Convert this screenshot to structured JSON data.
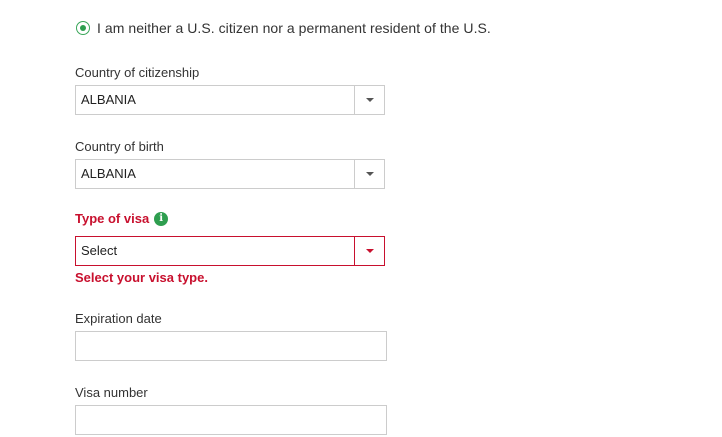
{
  "residency": {
    "option_label": "I am neither a U.S. citizen nor a permanent resident of the U.S.",
    "selected": true
  },
  "fields": {
    "citizenship": {
      "label": "Country of citizenship",
      "value": "ALBANIA"
    },
    "birth": {
      "label": "Country of birth",
      "value": "ALBANIA"
    },
    "visa_type": {
      "label": "Type of visa",
      "value": "Select",
      "error": "Select your visa type.",
      "info_icon": "i"
    },
    "expiration": {
      "label": "Expiration date",
      "value": ""
    },
    "visa_number": {
      "label": "Visa number",
      "value": ""
    }
  },
  "colors": {
    "error": "#c8102e",
    "accent": "#2e9e4f",
    "border": "#cccccc"
  }
}
